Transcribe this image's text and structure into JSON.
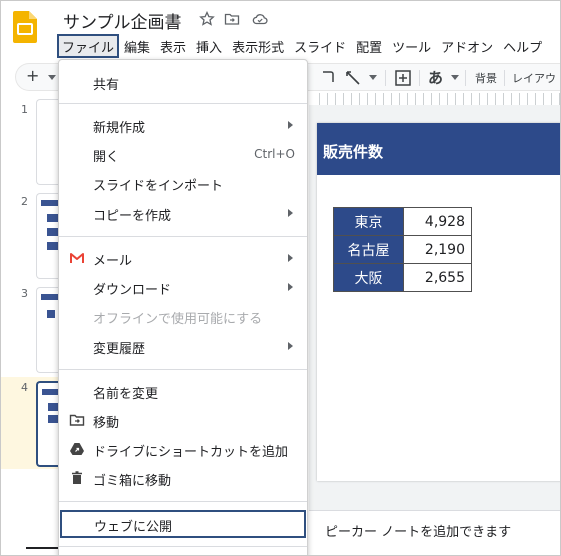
{
  "document": {
    "title": "サンプル企画書"
  },
  "menubar": {
    "items": [
      "ファイル",
      "編集",
      "表示",
      "挿入",
      "表示形式",
      "スライド",
      "配置",
      "ツール",
      "アドオン",
      "ヘルプ"
    ]
  },
  "toolbar": {
    "new_slide": "+",
    "hiragana": "あ",
    "background": "背景",
    "layout": "レイアウ"
  },
  "filmstrip": {
    "slide_numbers": [
      "1",
      "2",
      "3",
      "4"
    ],
    "selected": "4"
  },
  "slide": {
    "title_visible": "販売件数",
    "table": [
      {
        "city": "東京",
        "count": "4,928"
      },
      {
        "city": "名古屋",
        "count": "2,190"
      },
      {
        "city": "大阪",
        "count": "2,655"
      }
    ]
  },
  "notes": {
    "placeholder_visible": "ピーカー ノートを追加できます"
  },
  "file_menu": {
    "share": "共有",
    "new": "新規作成",
    "open": "開く",
    "open_shortcut": "Ctrl+O",
    "import_slides": "スライドをインポート",
    "make_copy": "コピーを作成",
    "email": "メール",
    "download": "ダウンロード",
    "offline": "オフラインで使用可能にする",
    "version_history": "変更履歴",
    "rename": "名前を変更",
    "move": "移動",
    "add_shortcut": "ドライブにショートカットを追加",
    "trash": "ゴミ箱に移動",
    "publish": "ウェブに公開"
  },
  "colors": {
    "accent_blue": "#2d4a8a",
    "highlight_border": "#2f4f7f",
    "gmail_red": "#ea4335",
    "slides_yellow": "#f4b400"
  }
}
